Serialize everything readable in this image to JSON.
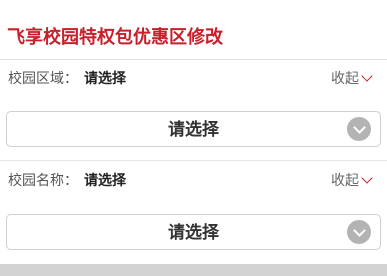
{
  "header": {
    "title": "飞享校园特权包优惠区修改"
  },
  "campus_region": {
    "label": "校园区域：",
    "value": "请选择",
    "collapse_label": "收起",
    "select_text": "请选择",
    "select_icon": "chevron-down-circle-icon"
  },
  "campus_name": {
    "label": "校园名称：",
    "value": "请选择",
    "collapse_label": "收起",
    "select_text": "请选择",
    "select_icon": "chevron-down-circle-icon"
  },
  "colors": {
    "accent": "#c8202b",
    "select_icon": "#b3b3b3",
    "footer_bar": "#d3d3d3"
  }
}
